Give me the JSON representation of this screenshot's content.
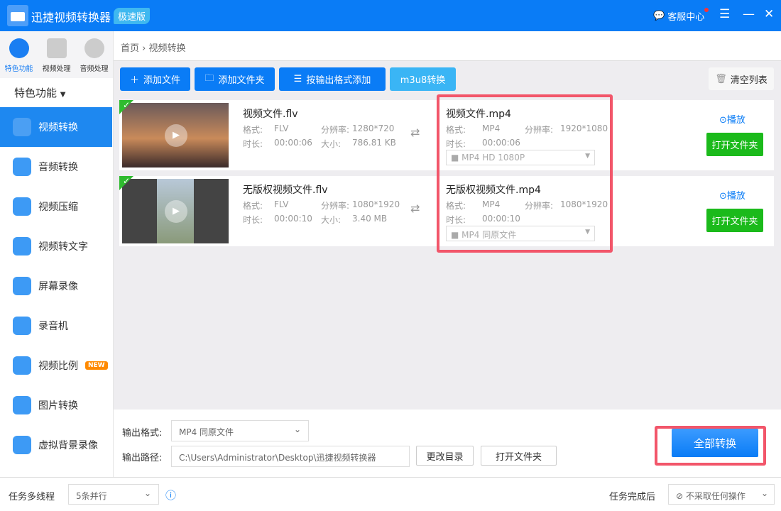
{
  "app": {
    "title": "迅捷视频转换器",
    "edition": "极速版",
    "service": "客服中心"
  },
  "side": {
    "cats": [
      "特色功能",
      "视频处理",
      "音频处理"
    ],
    "section": "特色功能",
    "items": [
      {
        "label": "视频转换"
      },
      {
        "label": "音频转换"
      },
      {
        "label": "视频压缩"
      },
      {
        "label": "视频转文字"
      },
      {
        "label": "屏幕录像"
      },
      {
        "label": "录音机"
      },
      {
        "label": "视频比例",
        "badge": "NEW"
      },
      {
        "label": "图片转换"
      },
      {
        "label": "虚拟背景录像"
      }
    ]
  },
  "breadcrumb": {
    "home": "首页",
    "sep": "›",
    "current": "视频转换"
  },
  "toolbar": {
    "add_file": "添加文件",
    "add_folder": "添加文件夹",
    "add_by_format": "按输出格式添加",
    "m3u8": "m3u8转换",
    "clear": "清空列表"
  },
  "labels": {
    "format": "格式:",
    "resolution": "分辨率:",
    "duration": "时长:",
    "size": "大小:",
    "play": "播放",
    "open_folder": "打开文件夹"
  },
  "files": [
    {
      "name": "视频文件.flv",
      "format": "FLV",
      "resolution": "1280*720",
      "duration": "00:00:06",
      "size": "786.81 KB",
      "out_name": "视频文件.mp4",
      "out_format": "MP4",
      "out_resolution": "1920*1080",
      "out_duration": "00:00:06",
      "out_preset": "MP4  HD 1080P"
    },
    {
      "name": "无版权视频文件.flv",
      "format": "FLV",
      "resolution": "1080*1920",
      "duration": "00:00:10",
      "size": "3.40 MB",
      "out_name": "无版权视频文件.mp4",
      "out_format": "MP4",
      "out_resolution": "1080*1920",
      "out_duration": "00:00:10",
      "out_preset": "MP4  同原文件"
    }
  ],
  "bottom": {
    "format_label": "输出格式:",
    "format_value": "MP4  同原文件",
    "path_label": "输出路径:",
    "path_value": "C:\\Users\\Administrator\\Desktop\\迅捷视频转换器",
    "change_dir": "更改目录",
    "open_folder": "打开文件夹",
    "convert_all": "全部转换"
  },
  "status": {
    "threads_label": "任务多线程",
    "threads_value": "5条并行",
    "after_label": "任务完成后",
    "after_value": "不采取任何操作"
  }
}
